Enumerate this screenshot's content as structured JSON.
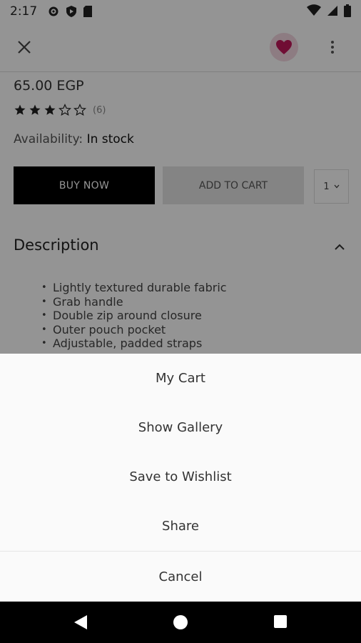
{
  "status_bar": {
    "time": "2:17"
  },
  "product": {
    "price": "65.00 EGP",
    "rating": 3,
    "rating_max": 5,
    "rating_count": "(6)",
    "availability_label": "Availability:",
    "availability_value": "In stock",
    "buy_now_label": "BUY NOW",
    "add_to_cart_label": "ADD TO CART",
    "quantity": "1"
  },
  "description": {
    "title": "Description",
    "bullets": [
      "Lightly textured durable fabric",
      "Grab handle",
      "Double zip around closure",
      "Outer pouch pocket",
      "Adjustable, padded straps"
    ]
  },
  "sheet": {
    "items": [
      "My Cart",
      "Show Gallery",
      "Save to Wishlist",
      "Share"
    ],
    "cancel": "Cancel"
  },
  "colors": {
    "accent": "#c2185b",
    "fav_bg": "#f3d6e0"
  },
  "icons": {
    "close": "close-icon",
    "favorite": "heart-icon",
    "more": "more-vert-icon",
    "collapse": "chevron-up-icon"
  }
}
